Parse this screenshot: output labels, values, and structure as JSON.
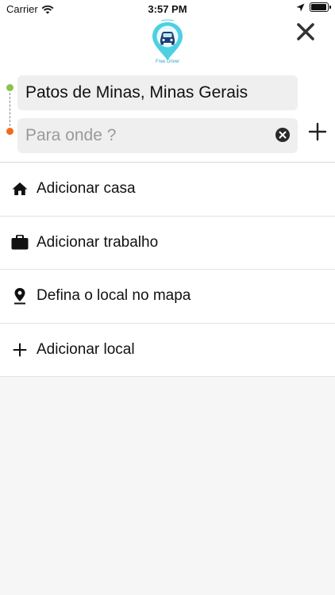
{
  "status_bar": {
    "carrier": "Carrier",
    "time": "3:57 PM",
    "battery_level": 0.95
  },
  "header": {
    "logo_caption": "Free Driver",
    "logo_color": "#4dd0e1"
  },
  "route": {
    "origin_value": "Patos de Minas, Minas Gerais",
    "destination_placeholder": "Para onde ?",
    "origin_dot_color": "#8bc34a",
    "destination_dot_color": "#f26b1d"
  },
  "list": {
    "items": [
      {
        "label": "Adicionar casa",
        "icon": "home-icon"
      },
      {
        "label": "Adicionar trabalho",
        "icon": "briefcase-icon"
      },
      {
        "label": "Defina o local no mapa",
        "icon": "map-pin-icon"
      },
      {
        "label": "Adicionar local",
        "icon": "plus-icon"
      }
    ]
  }
}
